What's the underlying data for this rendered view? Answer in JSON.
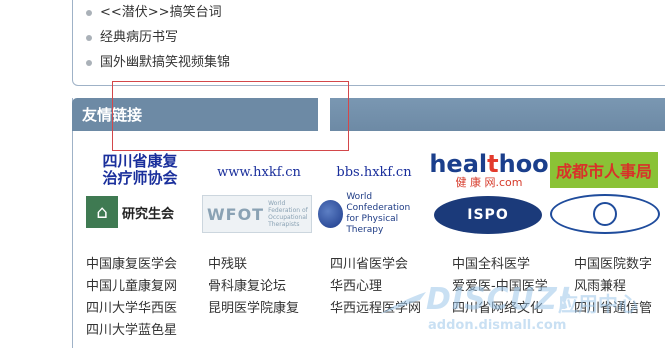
{
  "top_list": {
    "items": [
      "<<潜伏>>搞笑台词",
      "经典病历书写",
      "国外幽默搞笑视频集锦"
    ]
  },
  "links_panel": {
    "title": "友情链接",
    "logos": {
      "sichuan_rehab": [
        "四川省康复",
        "治疗师协会"
      ],
      "hxkf": "www.hxkf.cn",
      "bbs_hxkf": "bbs.hxkf.cn",
      "healthoo": {
        "main_a": "heal",
        "main_t": "t",
        "main_b": "hoo",
        "sub": "健 康 网.com"
      },
      "chengdu": "成都市人事局",
      "graduate": {
        "icon": "⌂",
        "text": "研究生会"
      },
      "wfot": {
        "main": "WFOT",
        "sub": "World Federation of Occupational Therapists"
      },
      "wcpt": [
        "World Confederation",
        "for Physical Therapy"
      ],
      "ispo": "ISPO"
    },
    "text_links": [
      [
        "中国康复医学会",
        "中残联",
        "四川省医学会",
        "中国全科医学",
        "中国医院数字"
      ],
      [
        "中国儿童康复网",
        "骨科康复论坛",
        "华西心理",
        "爱爱医-中国医学",
        "风雨兼程"
      ],
      [
        "四川大学华西医",
        "昆明医学院康复",
        "华西远程医学网",
        "四川省网络文化",
        "四川省通信管"
      ],
      [
        "四川大学蓝色星"
      ]
    ]
  },
  "watermark": {
    "main": "DISCUZ!",
    "cn": "应用中心",
    "sub": "addon.dismall.com"
  },
  "colors": {
    "tab_bg": "#6d8aa5",
    "border": "#9fb2c7",
    "annotation": "#d3474a",
    "logo_blue": "#1a2f9c"
  }
}
